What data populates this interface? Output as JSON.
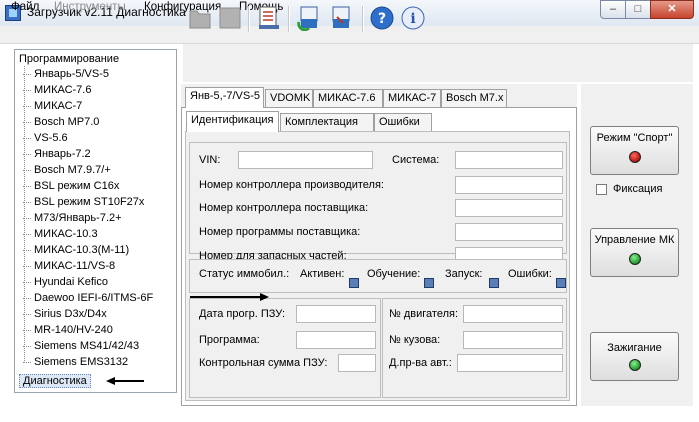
{
  "window": {
    "title": "Загрузчик v2.11 Диагностика",
    "min": "–",
    "max": "□",
    "close": "✕"
  },
  "menu": [
    "Файл",
    "Инструменты",
    "Конфигурация",
    "Помощь"
  ],
  "toolbar": {
    "icons": [
      "open-icon",
      "stop-icon",
      "checklist-icon",
      "read-icon",
      "write-icon",
      "help-icon",
      "info-icon"
    ]
  },
  "tree": {
    "root": "Программирование",
    "items": [
      "Январь-5/VS-5",
      "МИКАС-7.6",
      "МИКАС-7",
      "Bosch MP7.0",
      "VS-5.6",
      "Январь-7.2",
      "Bosch M7.9.7/+",
      "BSL режим C16x",
      "BSL режим ST10F27x",
      "M73/Январь-7.2+",
      "МИКАС-10.3",
      "МИКАС-10.3(М-11)",
      "МИКАС-11/VS-8",
      "Hyundai Kefico",
      "Daewoo IEFI-6/ITMS-6F",
      "Sirius D3x/D4x",
      "MR-140/HV-240",
      "Siemens MS41/42/43",
      "Siemens EMS3132"
    ],
    "selected": "Диагностика"
  },
  "tabs": [
    "Янв-5,-7/VS-5",
    "VDOMK",
    "МИКАС-7.6",
    "МИКАС-7",
    "Bosch M7.x"
  ],
  "subtabs": [
    "Идентификация",
    "Комплектация",
    "Ошибки"
  ],
  "ident": {
    "vin": "VIN:",
    "system": "Система:",
    "rows": [
      "Номер контроллера производителя:",
      "Номер контроллера поставщика:",
      "Номер программы поставщика:",
      "Номер для запасных частей:"
    ]
  },
  "immo": {
    "label": "Статус иммобил.:",
    "active": "Активен:",
    "learn": "Обучение:",
    "start": "Запуск:",
    "errors": "Ошибки:"
  },
  "rom": {
    "date": "Дата прогр. ПЗУ:",
    "program": "Программа:",
    "checksum": "Контрольная сумма ПЗУ:"
  },
  "engine": {
    "number": "№ двигателя:",
    "body": "№ кузова:",
    "maker": "Д.пр-ва авт.:"
  },
  "right": {
    "sport": "Режим \"Спорт\"",
    "fix": "Фиксация",
    "mk": "Управление МК",
    "ignition": "Зажигание"
  },
  "colors": {
    "led": "#5a7fb8",
    "bulb_red": "#c0201a",
    "bulb_green": "#2da53a"
  }
}
